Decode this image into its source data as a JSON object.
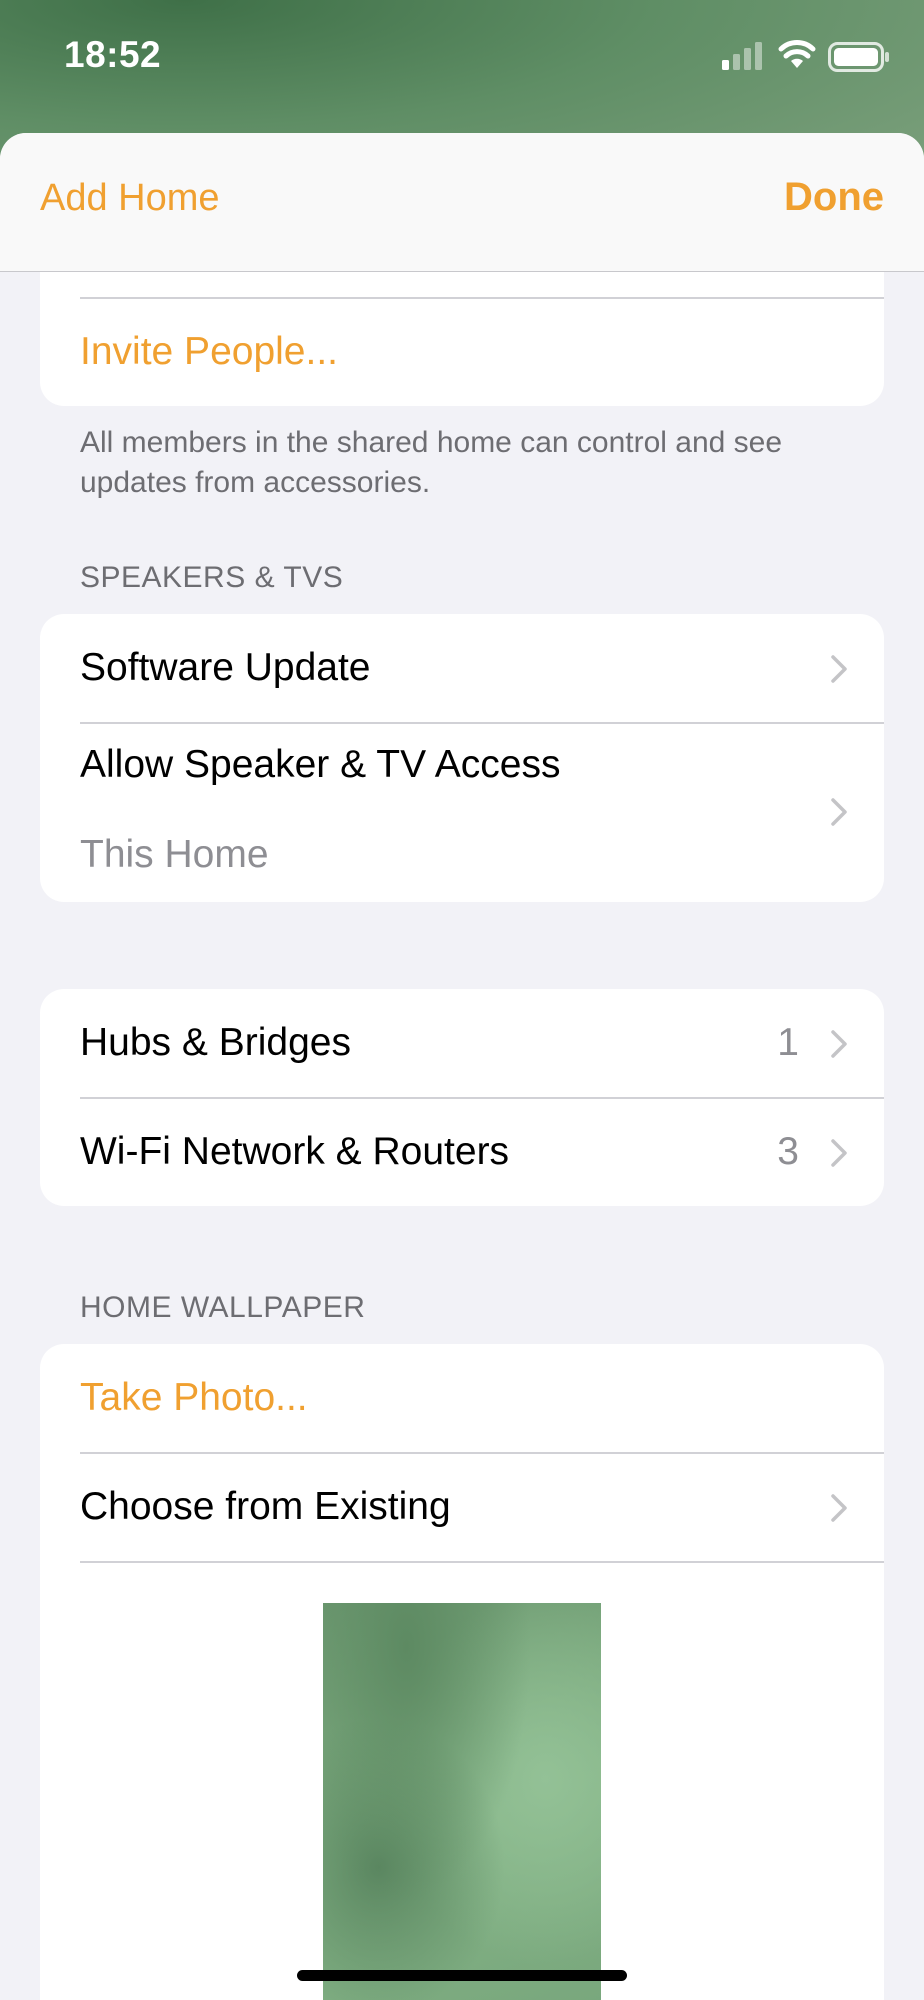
{
  "status": {
    "time": "18:52"
  },
  "nav": {
    "left": "Add Home",
    "right": "Done"
  },
  "sharing": {
    "invite_label": "Invite People...",
    "footer": "All members in the shared home can control and see updates from accessories."
  },
  "speakers": {
    "header": "SPEAKERS & TVS",
    "software_update": "Software Update",
    "allow_access": "Allow Speaker & TV Access",
    "allow_access_value": "This Home"
  },
  "network": {
    "hubs_label": "Hubs & Bridges",
    "hubs_count": "1",
    "wifi_label": "Wi-Fi Network & Routers",
    "wifi_count": "3"
  },
  "wallpaper": {
    "header": "HOME WALLPAPER",
    "take_photo": "Take Photo...",
    "choose_existing": "Choose from Existing"
  },
  "colors": {
    "accent": "#f0a030",
    "background": "#f2f2f7",
    "secondary_text": "#8e8e93"
  }
}
